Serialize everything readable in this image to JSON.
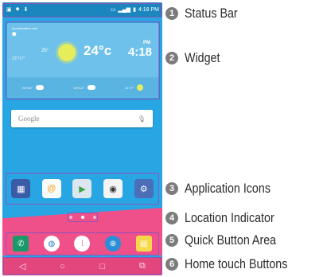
{
  "status_bar": {
    "time": "4:18 PM",
    "left_icons": [
      "photo-icon",
      "location-icon",
      "download-icon"
    ]
  },
  "widget": {
    "site": "AccuWeather.com",
    "current_temp": "24°c",
    "low_temp": "23°/17°",
    "high_temp": "25°",
    "clock_ampm": "PM",
    "clock_time": "4:18",
    "forecast": [
      "24°/15°",
      "23°/12°",
      "21°/7°"
    ]
  },
  "search_bar": {
    "logo_text": "Google"
  },
  "app_icons": [
    "gallery-icon",
    "email-icon",
    "play-store-icon",
    "camera-icon",
    "settings-icon"
  ],
  "quick_buttons": [
    "phone-icon",
    "contacts-icon",
    "apps-icon",
    "browser-icon",
    "memo-icon"
  ],
  "home_buttons": {
    "back": "◁",
    "home": "○",
    "recent": "□",
    "dual_window": "⧉"
  },
  "location_indicator": {
    "pages": 3,
    "active": 2
  },
  "callouts": [
    {
      "number": "1",
      "label": "Status Bar"
    },
    {
      "number": "2",
      "label": "Widget"
    },
    {
      "number": "3",
      "label": "Application Icons"
    },
    {
      "number": "4",
      "label": "Location Indicator"
    },
    {
      "number": "5",
      "label": "Quick Button Area"
    },
    {
      "number": "6",
      "label": "Home touch Buttons"
    }
  ],
  "colors": {
    "screen_bg": "#27a6e3",
    "highlight_border": "#8e54b8",
    "dock_pink": "#f0508a",
    "callout_circle": "#7c7c7c"
  }
}
